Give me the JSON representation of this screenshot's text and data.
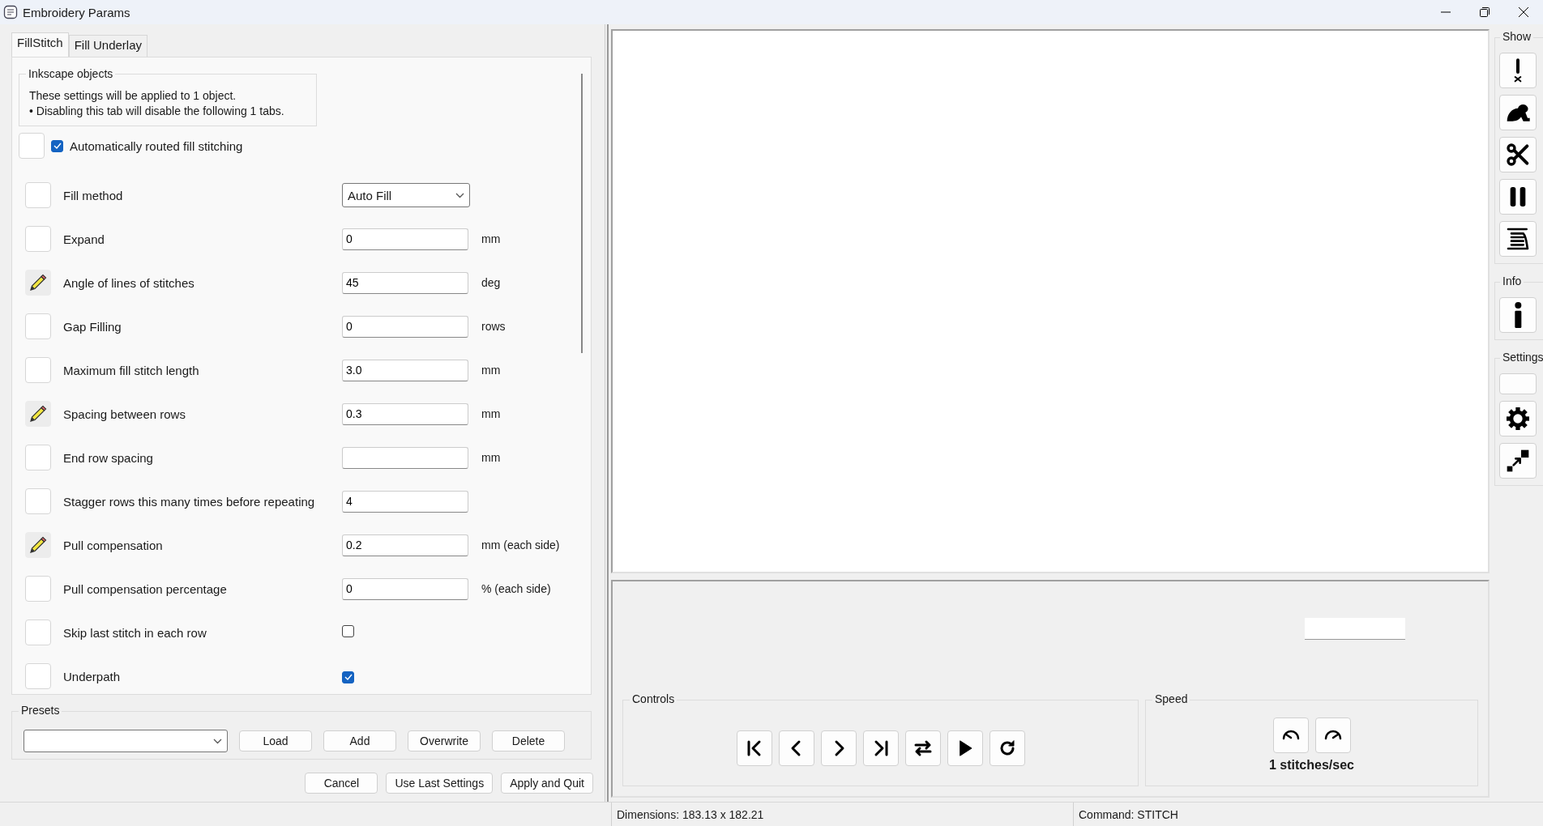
{
  "window": {
    "title": "Embroidery Params"
  },
  "tabs": [
    {
      "label": "FillStitch",
      "selected": true
    },
    {
      "label": "Fill Underlay",
      "selected": false
    }
  ],
  "object_info": {
    "title": "Inkscape objects",
    "lines": [
      "These settings will be applied to 1 object.",
      "• Disabling this tab will disable the following 1 tabs."
    ]
  },
  "enable": {
    "label": "Automatically routed fill stitching",
    "checked": true
  },
  "params": [
    {
      "kind": "select",
      "label": "Fill method",
      "value": "Auto Fill",
      "modified": false
    },
    {
      "kind": "number",
      "label": "Expand",
      "value": "0",
      "unit": "mm",
      "modified": false
    },
    {
      "kind": "number",
      "label": "Angle of lines of stitches",
      "value": "45",
      "unit": "deg",
      "modified": true
    },
    {
      "kind": "number",
      "label": "Gap Filling",
      "value": "0",
      "unit": "rows",
      "modified": false
    },
    {
      "kind": "number",
      "label": "Maximum fill stitch length",
      "value": "3.0",
      "unit": "mm",
      "modified": false
    },
    {
      "kind": "number",
      "label": "Spacing between rows",
      "value": "0.3",
      "unit": "mm",
      "modified": true
    },
    {
      "kind": "number",
      "label": "End row spacing",
      "unit": "mm",
      "modified": false
    },
    {
      "kind": "number",
      "label": "Stagger rows this many times before repeating",
      "value": "4",
      "modified": false
    },
    {
      "kind": "number",
      "label": "Pull compensation",
      "value": "0.2",
      "unit": "mm (each side)",
      "modified": true
    },
    {
      "kind": "number",
      "label": "Pull compensation percentage",
      "value": "0",
      "unit": "% (each side)",
      "modified": false
    },
    {
      "kind": "checkbox",
      "label": "Skip last stitch in each row",
      "checked": false,
      "modified": false
    },
    {
      "kind": "checkbox",
      "label": "Underpath",
      "checked": true,
      "modified": false
    }
  ],
  "presets": {
    "title": "Presets",
    "buttons": [
      "Load",
      "Add",
      "Overwrite",
      "Delete"
    ]
  },
  "buttons": [
    "Cancel",
    "Use Last Settings",
    "Apply and Quit"
  ],
  "controls": {
    "title": "Controls",
    "buttons": [
      {
        "kind": "first"
      },
      {
        "kind": "prev"
      },
      {
        "kind": "next"
      },
      {
        "kind": "last"
      },
      {
        "kind": "swap"
      },
      {
        "kind": "play"
      },
      {
        "kind": "reload"
      }
    ]
  },
  "speed": {
    "title": "Speed",
    "buttons": [
      {
        "kind": "slower"
      },
      {
        "kind": "faster"
      }
    ],
    "reading": "1 stitches/sec"
  },
  "toolbar": [
    {
      "title": "Show",
      "tools": [
        {
          "kind": "warning"
        },
        {
          "kind": "frog"
        },
        {
          "kind": "scissors"
        },
        {
          "kind": "pause"
        },
        {
          "kind": "spool"
        }
      ]
    },
    {
      "title": "Info",
      "tools": [
        {
          "kind": "info"
        }
      ]
    },
    {
      "title": "Settings",
      "tools": [
        {
          "kind": "blank"
        },
        {
          "kind": "gear"
        },
        {
          "kind": "resize"
        }
      ]
    }
  ],
  "status_bar": [
    "Dimensions: 183.13 x 182.21",
    "Command: STITCH"
  ]
}
